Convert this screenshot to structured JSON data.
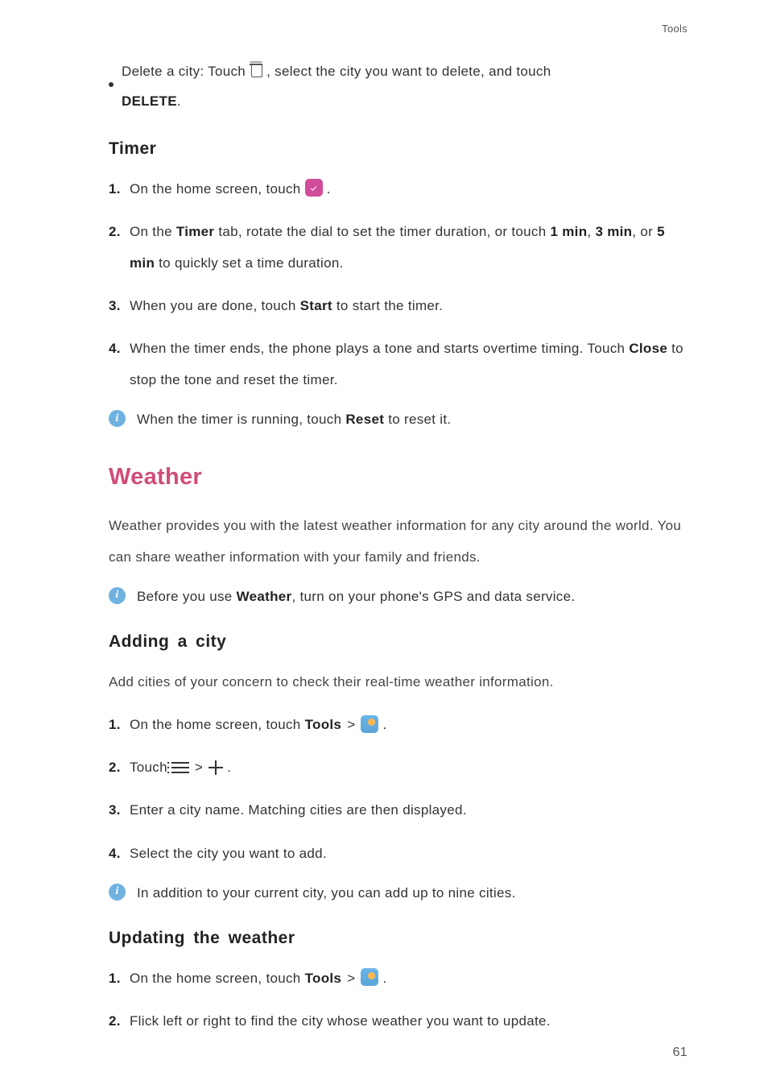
{
  "header": {
    "section": "Tools"
  },
  "delete_city": {
    "prefix": "Delete a city: Touch ",
    "mid": " , select the city you want to delete, and touch ",
    "action": "DELETE",
    "suffix": "."
  },
  "timer": {
    "heading": "Timer",
    "steps": [
      {
        "pre": "On the home screen, touch ",
        "post": " ."
      },
      {
        "pre": "On the ",
        "b1": "Timer",
        "mid1": " tab, rotate the dial to set the timer duration, or touch ",
        "b2": "1 min",
        "mid2": ", ",
        "b3": "3 min",
        "mid3": ", or ",
        "b4": "5 min",
        "post": " to quickly set a time duration."
      },
      {
        "pre": "When you are done, touch ",
        "b1": "Start",
        "post": " to start the timer."
      },
      {
        "pre": "When the timer ends, the phone plays a tone and starts overtime timing. Touch ",
        "b1": "Close",
        "post": " to stop the tone and reset the timer."
      }
    ],
    "note": {
      "pre": "When the timer is running, touch ",
      "b": "Reset",
      "post": " to reset it."
    }
  },
  "weather": {
    "heading": "Weather",
    "intro": "Weather provides you with the latest weather information for any city around the world. You can share weather information with your family and friends.",
    "note": {
      "pre": "Before you use ",
      "b": "Weather",
      "post": ", turn on your phone's GPS and data service."
    }
  },
  "adding": {
    "heading": "Adding a city",
    "intro": "Add cities of your concern to check their real-time weather information.",
    "steps": [
      {
        "pre": "On the home screen, touch ",
        "b": "Tools",
        "gt": " > ",
        "post": " ."
      },
      {
        "pre": "Touch ",
        "gt": " > ",
        "post": " ."
      },
      {
        "text": "Enter a city name. Matching cities are then displayed."
      },
      {
        "text": "Select the city you want to add."
      }
    ],
    "note": "In addition to your current city, you can add up to nine cities."
  },
  "updating": {
    "heading": "Updating the weather",
    "steps": [
      {
        "pre": "On the home screen, touch ",
        "b": "Tools",
        "gt": " > ",
        "post": " ."
      },
      {
        "text": "Flick left or right to find the city whose weather you want to update."
      }
    ]
  },
  "page_number": "61"
}
